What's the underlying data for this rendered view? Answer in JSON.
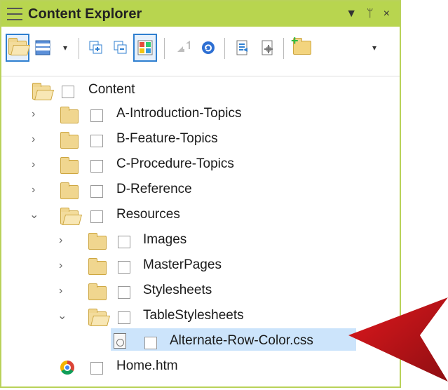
{
  "titlebar": {
    "title": "Content Explorer",
    "controls": [
      "▼",
      "ᛘ",
      "×"
    ]
  },
  "toolbar": {
    "buttons": [
      "folder-open-icon",
      "table-view-icon",
      "dropdown-arrow-icon",
      "expand-all-icon",
      "collapse-all-icon",
      "color-grid-icon",
      "back-arrow-icon",
      "refresh-icon",
      "topic-icon",
      "settings-icon",
      "new-folder-icon",
      "more-icon"
    ]
  },
  "tree": {
    "root": "Content",
    "items": [
      {
        "label": "A-Introduction-Topics"
      },
      {
        "label": "B-Feature-Topics"
      },
      {
        "label": "C-Procedure-Topics"
      },
      {
        "label": "D-Reference"
      },
      {
        "label": "Resources"
      },
      {
        "label": "Images"
      },
      {
        "label": "MasterPages"
      },
      {
        "label": "Stylesheets"
      },
      {
        "label": "TableStylesheets"
      },
      {
        "label": "Alternate-Row-Color.css"
      },
      {
        "label": "Home.htm"
      }
    ]
  },
  "colors": {
    "titlebar": "#b8d54f",
    "selection": "#cce4fb",
    "accent": "#2f7fd0",
    "arrow": "#c3161c"
  }
}
